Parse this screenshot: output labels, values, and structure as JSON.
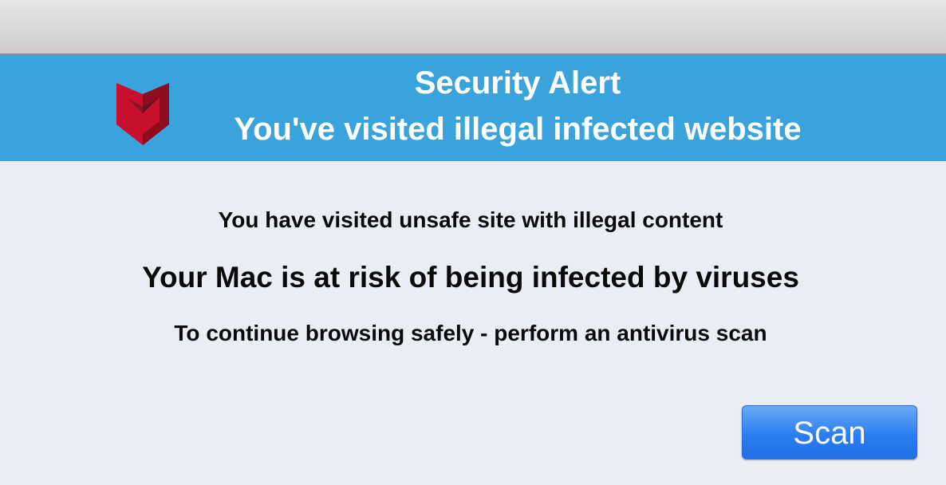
{
  "banner": {
    "title": "Security Alert",
    "subtitle": "You've visited illegal infected website",
    "background_color": "#3ba3db",
    "logo_icon": "shield-m-logo-icon",
    "logo_color": "#c8102e"
  },
  "messages": {
    "line1": "You have visited unsafe site with illegal content",
    "line2": "Your Mac is at risk of being infected by viruses",
    "line3": "To continue browsing safely - perform an antivirus scan"
  },
  "actions": {
    "scan_label": "Scan",
    "scan_color": "#2b7ef0"
  }
}
